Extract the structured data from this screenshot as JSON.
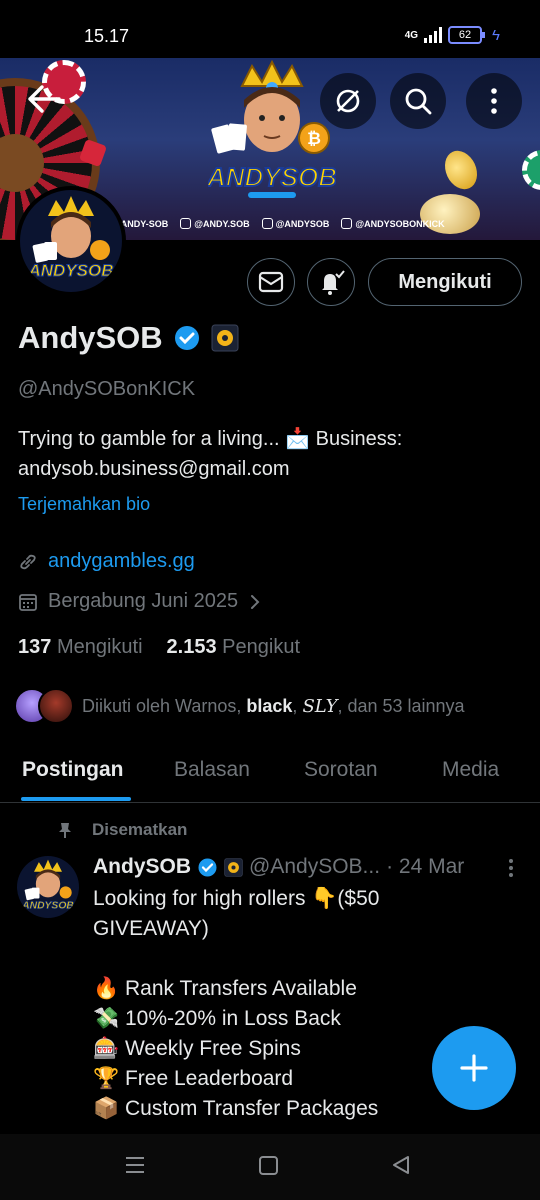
{
  "status_bar": {
    "time": "15.17",
    "network": "4G",
    "battery": "62"
  },
  "banner": {
    "logo_text": "ANDYSOB",
    "socials": [
      "@ANDY-SOB",
      "@ANDY.SOB",
      "@ANDYSOB",
      "@ANDYSOBONKICK"
    ]
  },
  "profile": {
    "display_name": "AndySOB",
    "handle": "@AndySOBonKICK",
    "bio_line1": "Trying to gamble for a living... 📩 Business:",
    "bio_line2": "andysob.business@gmail.com",
    "translate_label": "Terjemahkan bio",
    "website": "andygambles.gg",
    "joined": "Bergabung Juni 2025",
    "following_count": "137",
    "following_label": "Mengikuti",
    "followers_count": "2.153",
    "followers_label": "Pengikut",
    "follow_button": "Mengikuti",
    "followed_by_prefix": "Diikuti oleh Warnos, ",
    "followed_by_bold": "black",
    "followed_by_sep": ", ",
    "followed_by_italic": "SLY",
    "followed_by_suffix": ", dan 53 lainnya"
  },
  "tabs": [
    "Postingan",
    "Balasan",
    "Sorotan",
    "Media"
  ],
  "post": {
    "pinned_label": "Disematkan",
    "name": "AndySOB",
    "handle": "@AndySOB...",
    "time": "· 24 Mar",
    "lines": [
      "Looking for high rollers 👇($50",
      "GIVEAWAY)",
      "",
      "🔥 Rank Transfers Available",
      "💸 10%-20% in Loss Back",
      "🎰 Weekly Free Spins",
      "🏆 Free Leaderboard",
      "📦 Custom Transfer Packages"
    ]
  },
  "colors": {
    "accent": "#1d9bf0",
    "muted": "#71767b",
    "text": "#e7e9ea",
    "background": "#000000"
  }
}
